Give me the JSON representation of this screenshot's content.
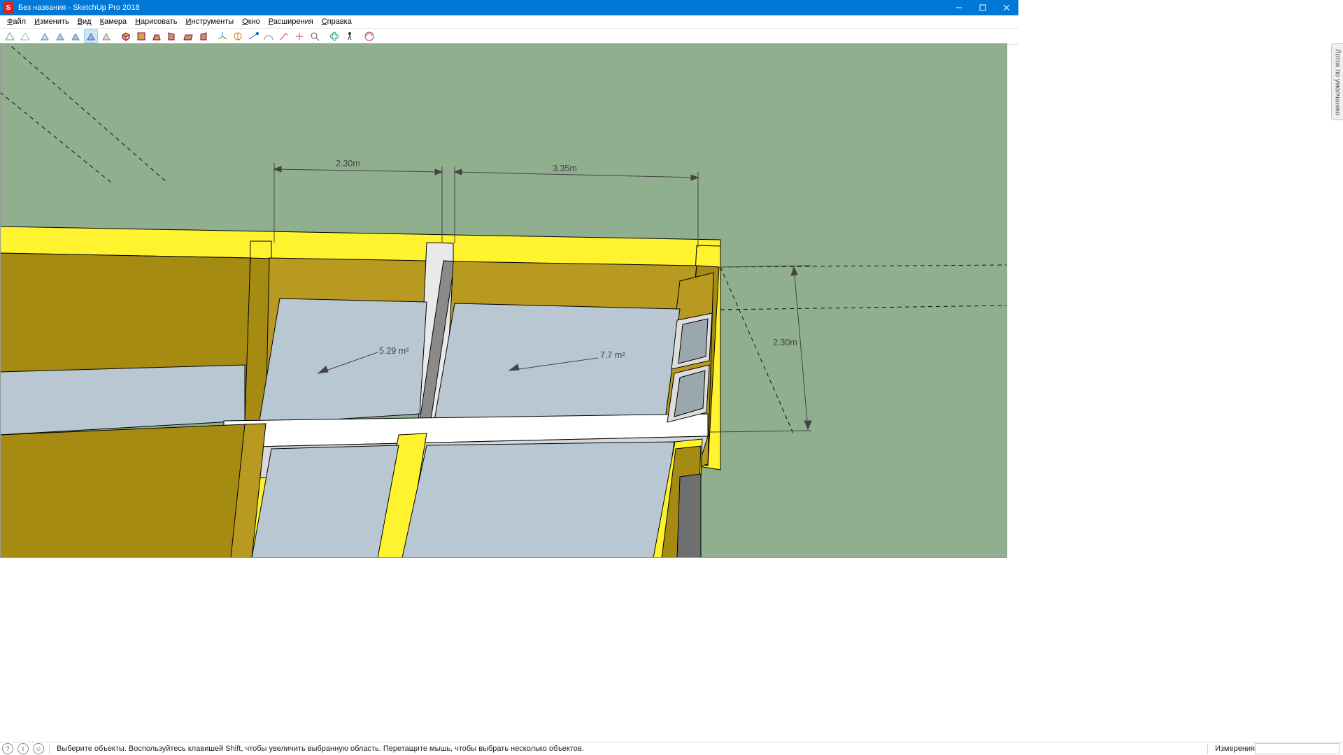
{
  "window": {
    "title": "Без названия - SketchUp Pro 2018",
    "app_letter": "S"
  },
  "menu": {
    "file": "Файл",
    "edit": "Изменить",
    "view": "Вид",
    "camera": "Камера",
    "draw": "Нарисовать",
    "tools": "Инструменты",
    "window": "Окно",
    "extensions": "Расширения",
    "help": "Справка"
  },
  "side_panel": {
    "label": "Лоток по умолчанию"
  },
  "statusbar": {
    "hint": "Выберите объекты. Воспользуйтесь клавишей Shift, чтобы увеличить выбранную область. Перетащите мышь, чтобы выбрать несколько объектов.",
    "measure_label": "Измерения"
  },
  "dimensions": {
    "top_left": "2.30m",
    "top_right": "3.35m",
    "side": "2.30m",
    "area_left": "5.29 m²",
    "area_right": "7.7 m²"
  },
  "colors": {
    "ground": "#8faf8e",
    "wall_top": "#fff22e",
    "wall_inner": "#a68b12",
    "wall_inner2": "#b79a1f",
    "floor": "#b9c7d3",
    "divider_light": "#e9e9e9",
    "divider_shadow": "#8a8a8a"
  }
}
